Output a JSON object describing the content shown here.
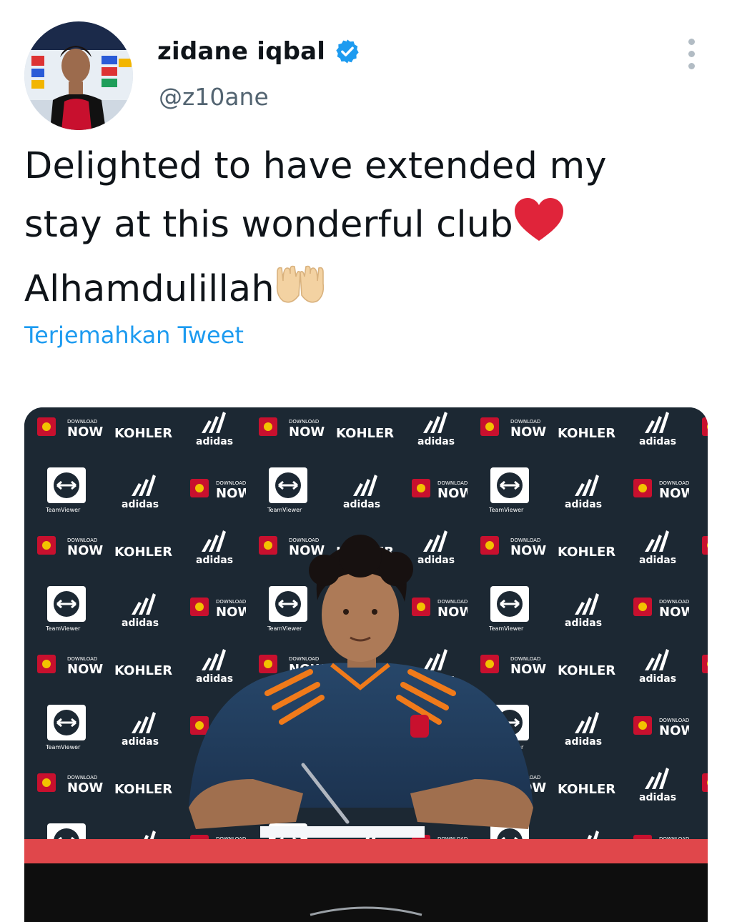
{
  "author": {
    "name": "zidane iqbal",
    "handle": "@z10ane",
    "verified_icon": "verified-badge-icon",
    "avatar_icon": "profile-avatar"
  },
  "tweet": {
    "line1": "Delighted to have extended my",
    "line2": "stay at this wonderful club",
    "line3": "Alhamdulillah",
    "emoji_heart": "red-heart-emoji",
    "emoji_hands": "palms-up-together-emoji"
  },
  "translate_label": "Terjemahkan Tweet",
  "media": {
    "description_icon": "contract-signing-photo",
    "backdrop_words": [
      "DOWNLOAD",
      "NOW",
      "KOHLER",
      "adidas",
      "TeamViewer"
    ]
  },
  "colors": {
    "link": "#1d9bf0",
    "verified": "#1d9bf0",
    "heart": "#e0243a",
    "table": "#e0474b"
  }
}
